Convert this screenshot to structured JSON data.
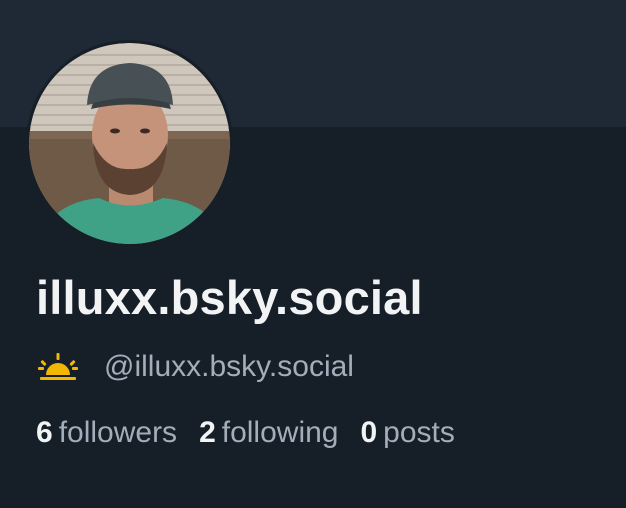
{
  "profile": {
    "display_name": "illuxx.bsky.social",
    "handle": "@illuxx.bsky.social",
    "handle_icon": "sunrise-icon",
    "avatar_icon": "user-photo"
  },
  "stats": {
    "followers_count": "6",
    "followers_label": "followers",
    "following_count": "2",
    "following_label": "following",
    "posts_count": "0",
    "posts_label": "posts"
  },
  "colors": {
    "background": "#161e27",
    "banner": "#1e2935",
    "text_primary": "#f1f3f5",
    "text_secondary": "#a3aebb",
    "icon_accent": "#f2b705"
  }
}
